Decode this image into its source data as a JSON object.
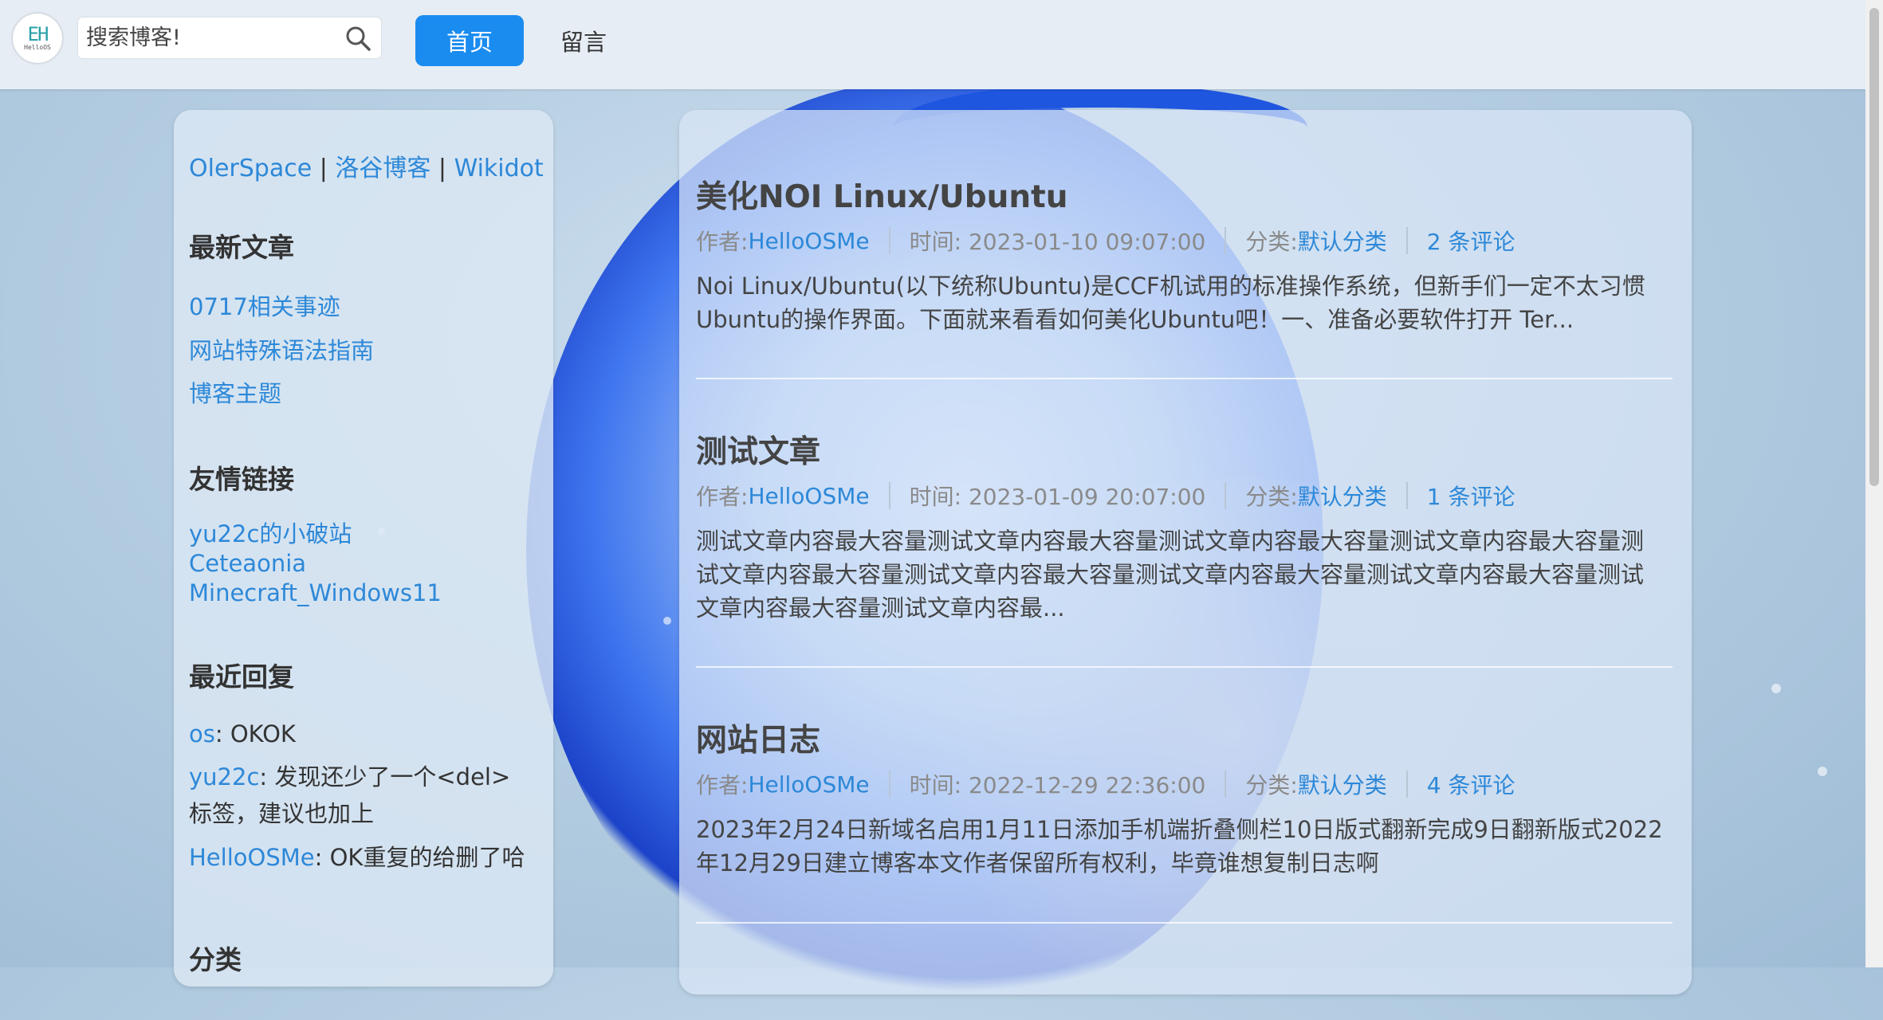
{
  "header": {
    "logo_mark": "EH",
    "logo_sub": "HelloOS",
    "search_placeholder": "搜索博客!",
    "nav": {
      "home": "首页",
      "messages": "留言"
    }
  },
  "sidebar": {
    "links": [
      "OlerSpace",
      "洛谷博客",
      "Wikidot"
    ],
    "link_sep": "|",
    "latest_heading": "最新文章",
    "latest": [
      "0717相关事迹",
      "网站特殊语法指南",
      "博客主题"
    ],
    "friends_heading": "友情链接",
    "friends": [
      "yu22c的小破站",
      "Ceteaonia",
      "Minecraft_Windows11"
    ],
    "replies_heading": "最近回复",
    "replies": [
      {
        "user": "os",
        "text": ": OKOK"
      },
      {
        "user": "yu22c",
        "text": ": 发现还少了一个<del>标签，建议也加上"
      },
      {
        "user": "HelloOSMe",
        "text": ": OK重复的给删了哈"
      }
    ],
    "categories_heading": "分类"
  },
  "posts": [
    {
      "title": "美化NOI Linux/Ubuntu",
      "author_label": "作者: ",
      "author": "HelloOSMe",
      "time": "时间: 2023-01-10 09:07:00",
      "category_label": "分类: ",
      "category": "默认分类",
      "comments": "2 条评论",
      "excerpt": "Noi Linux/Ubuntu(以下统称Ubuntu)是CCF机试用的标准操作系统，但新手们一定不太习惯Ubuntu的操作界面。下面就来看看如何美化Ubuntu吧！一、准备必要软件打开 Ter..."
    },
    {
      "title": "测试文章",
      "author_label": "作者: ",
      "author": "HelloOSMe",
      "time": "时间: 2023-01-09 20:07:00",
      "category_label": "分类: ",
      "category": "默认分类",
      "comments": "1 条评论",
      "excerpt": "测试文章内容最大容量测试文章内容最大容量测试文章内容最大容量测试文章内容最大容量测试文章内容最大容量测试文章内容最大容量测试文章内容最大容量测试文章内容最大容量测试文章内容最大容量测试文章内容最..."
    },
    {
      "title": "网站日志",
      "author_label": "作者: ",
      "author": "HelloOSMe",
      "time": "时间: 2022-12-29 22:36:00",
      "category_label": "分类: ",
      "category": "默认分类",
      "comments": "4 条评论",
      "excerpt": "2023年2月24日新域名启用1月11日添加手机端折叠侧栏10日版式翻新完成9日翻新版式2022年12月29日建立博客本文作者保留所有权利，毕竟谁想复制日志啊"
    }
  ],
  "colors": {
    "accent": "#1a8cf0",
    "link": "#2d88d8"
  }
}
